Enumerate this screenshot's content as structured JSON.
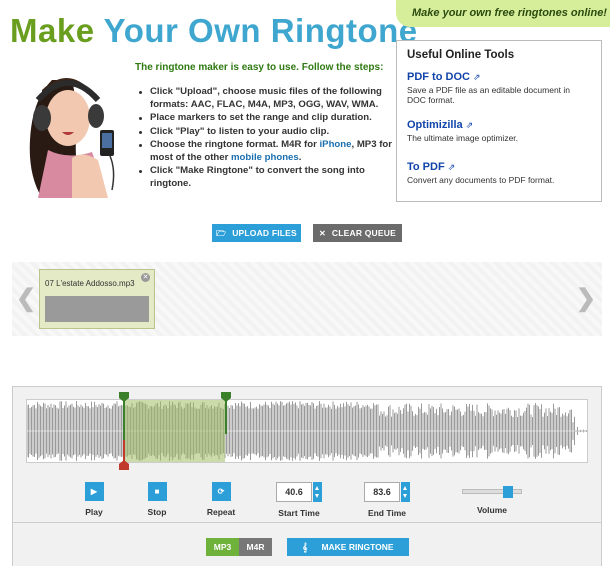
{
  "header": {
    "title_part1": "Make",
    "title_part2": "Your Own Ringtone",
    "promo": "Make your own free ringtones online!"
  },
  "intro": {
    "text": "The ringtone maker is easy to use. Follow the steps:",
    "steps": [
      "Click \"Upload\", choose music files of the following formats: AAC, FLAC, M4A, MP3, OGG, WAV, WMA.",
      "Place markers to set the range and clip duration.",
      "Click \"Play\" to listen to your audio clip."
    ],
    "step4_a": "Choose the ringtone format. M4R for",
    "step4_iphone": "iPhone",
    "step4_b": ", MP3 for most of the other",
    "step4_mobile": "mobile phones",
    "step4_c": ".",
    "step5": "Click \"Make Ringtone\" to convert the song into ringtone."
  },
  "tools": {
    "heading": "Useful Online Tools",
    "items": [
      {
        "name": "PDF to DOC",
        "ext": "⇗",
        "desc": "Save a PDF file as an editable document in DOC format."
      },
      {
        "name": "Optimizilla",
        "ext": "⇗",
        "desc": "The ultimate image optimizer."
      },
      {
        "name": "To PDF",
        "ext": "⇗",
        "desc": "Convert any documents to PDF format."
      }
    ]
  },
  "actions": {
    "upload_label": "UPLOAD FILES",
    "upload_icon": "🗁",
    "clear_label": "CLEAR QUEUE",
    "clear_icon": "✕"
  },
  "queue": {
    "left_arrow": "❮",
    "right_arrow": "❯",
    "items": [
      {
        "filename": "07 L'estate Addosso.mp3",
        "close": "✕"
      }
    ]
  },
  "editor": {
    "play_label": "Play",
    "play_icon": "▶",
    "stop_label": "Stop",
    "stop_icon": "■",
    "repeat_label": "Repeat",
    "repeat_icon": "⟳",
    "start_time_label": "Start Time",
    "start_time": "40.6",
    "end_time_label": "End Time",
    "end_time": "83.6",
    "volume_label": "Volume",
    "volume_level": 0.8,
    "format_mp3": "MP3",
    "format_m4r": "M4R",
    "make_label": "MAKE RINGTONE",
    "make_icon": "𝄞",
    "colors": {
      "accent": "#2d9fd8",
      "selected_format": "#6fb23b",
      "waveform": "#9a9a9a",
      "marker": "#3a7f2a",
      "playhead": "#c0392b"
    }
  }
}
